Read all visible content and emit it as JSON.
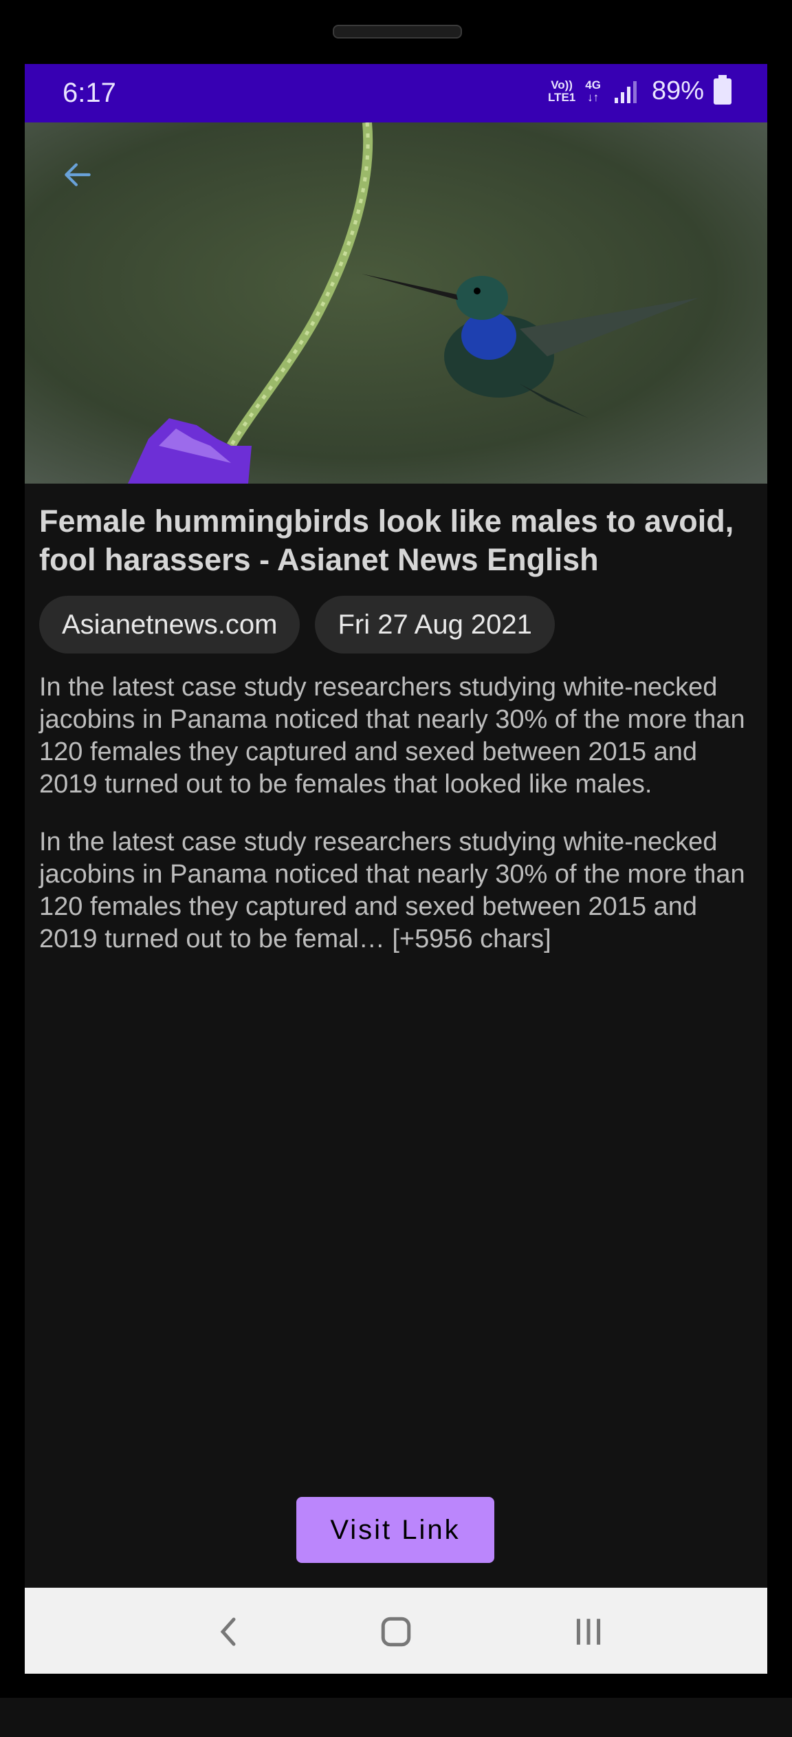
{
  "status_bar": {
    "time": "6:17",
    "network_top": "Vo))",
    "network_bottom": "LTE1",
    "network_gen": "4G",
    "battery": "89%"
  },
  "article": {
    "title": "Female hummingbirds look like males to avoid, fool harassers - Asianet News English",
    "source": "Asianetnews.com",
    "date": "Fri 27 Aug 2021",
    "description": "In the latest case study researchers studying white-necked jacobins in Panama noticed that nearly 30% of the more than 120 females they captured and sexed between 2015 and 2019 turned out to be females that looked like males.",
    "content": "In the latest case study researchers studying white-necked jacobins in Panama noticed that nearly 30% of the more than 120 females they captured and sexed between 2015 and 2019 turned out to be femal… [+5956 chars]"
  },
  "actions": {
    "visit_label": "Visit Link"
  },
  "icons": {
    "back": "arrow-back-icon",
    "nav_back": "chevron-left-icon",
    "nav_home": "home-icon",
    "nav_recents": "recents-icon"
  },
  "colors": {
    "status_bar": "#3700b3",
    "accent": "#bb86fc",
    "background": "#121212",
    "back_arrow": "#69a2d9"
  }
}
